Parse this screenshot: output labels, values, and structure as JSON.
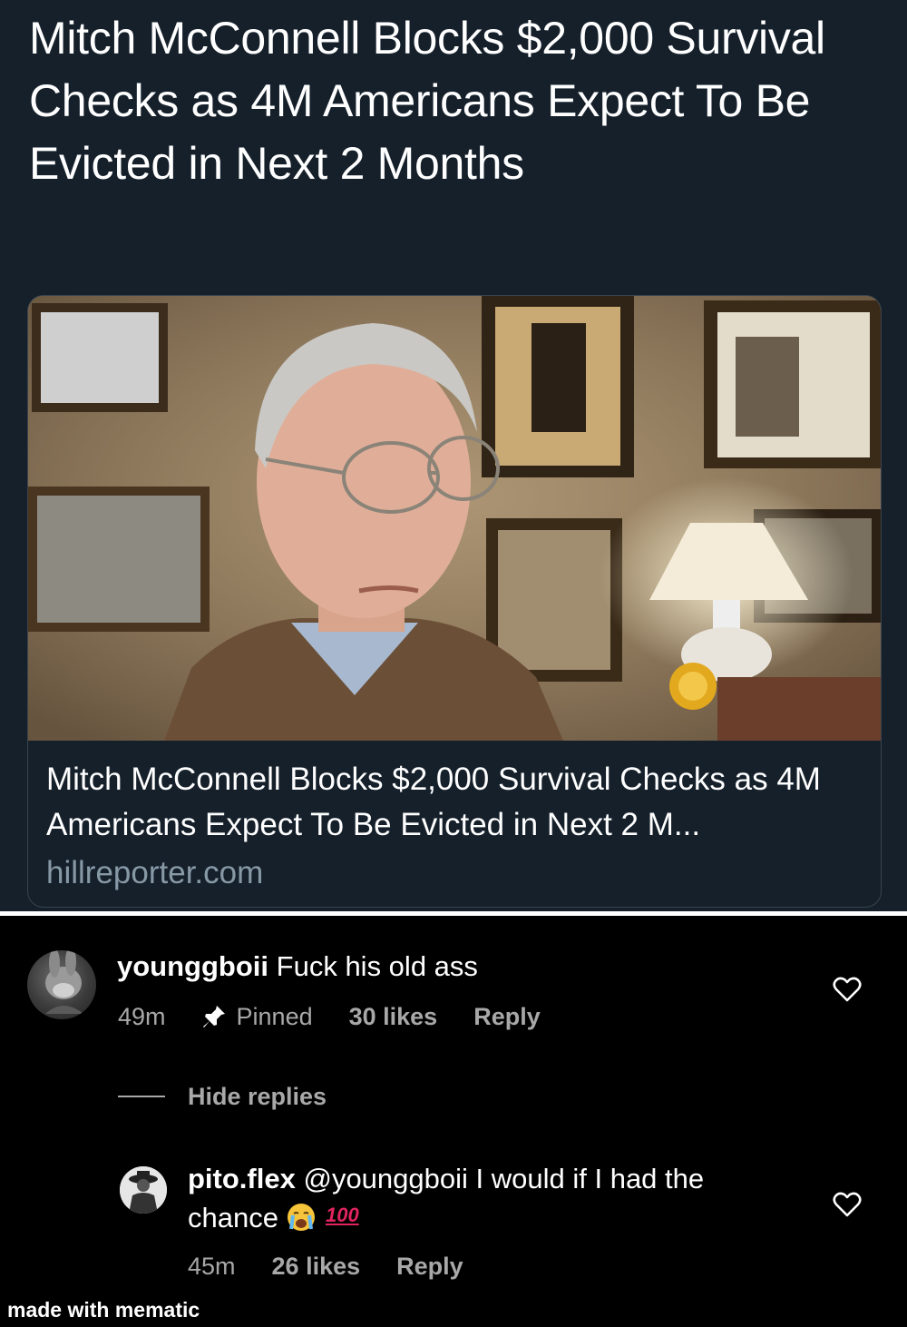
{
  "tweet": {
    "headline": "Mitch McConnell Blocks $2,000 Survival Checks as 4M Americans Expect To Be Evicted in Next 2 Months",
    "card": {
      "title": "Mitch McConnell Blocks $2,000 Survival Checks as 4M Americans Expect To Be Evicted in Next 2 M...",
      "domain": "hillreporter.com"
    },
    "colors": {
      "background": "#15202b",
      "card_border": "#38444d",
      "domain": "#8899a6"
    }
  },
  "comments": {
    "main": {
      "username": "younggboii",
      "text": "Fuck his old ass",
      "time": "49m",
      "pinned_label": "Pinned",
      "likes": "30 likes",
      "reply_label": "Reply"
    },
    "hide_replies_label": "Hide replies",
    "reply": {
      "username": "pito.flex",
      "mention": "@younggboii",
      "text_line1": "I would if I had the",
      "text_line2": "chance",
      "emoji_100": "100",
      "time": "45m",
      "likes": "26 likes",
      "reply_label": "Reply"
    },
    "icons": [
      "pin-icon",
      "heart-icon",
      "crying-face-emoji",
      "hundred-points-emoji"
    ]
  },
  "watermark": "made with mematic"
}
